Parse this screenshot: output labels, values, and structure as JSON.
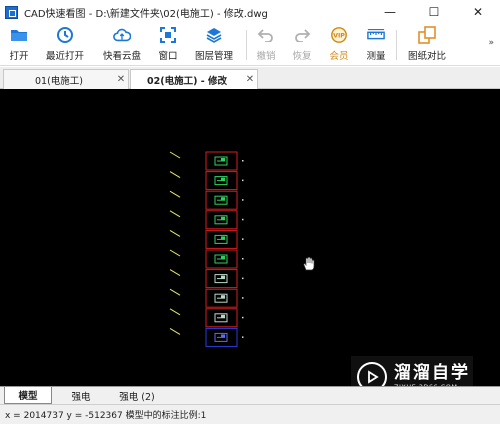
{
  "window": {
    "title": "CAD快速看图 - D:\\新建文件夹\\02(电施工) - 修改.dwg",
    "controls": {
      "minimize": "—",
      "maximize": "☐",
      "close": "✕"
    }
  },
  "toolbar": {
    "open": "打开",
    "recent": "最近打开",
    "cloud": "快看云盘",
    "window": "窗口",
    "layers": "图层管理",
    "undo": "撤销",
    "redo": "恢复",
    "vip": "会员",
    "vip_badge": "VIP",
    "measure": "测量",
    "compare": "图纸对比",
    "more": "»"
  },
  "doc_tabs": [
    {
      "label": "01(电施工)",
      "close": "✕"
    },
    {
      "label": "02(电施工) - 修改",
      "close": "✕"
    }
  ],
  "layout_tabs": [
    "模型",
    "强电",
    "强电 (2)"
  ],
  "status": {
    "text": "x = 2014737  y = -512367   模型中的标注比例:1"
  },
  "watermark": {
    "name": "溜溜自学",
    "url": "ZIXUE.3D66.COM"
  },
  "colors": {
    "accent_blue": "#1c78d8",
    "vip_gold": "#d08a16",
    "canvas_bg": "#000000",
    "frame_red": "#d42020",
    "frame_blue": "#2a3ee0",
    "leader_yellow": "#e8e860",
    "detail_green": "#30d060"
  }
}
